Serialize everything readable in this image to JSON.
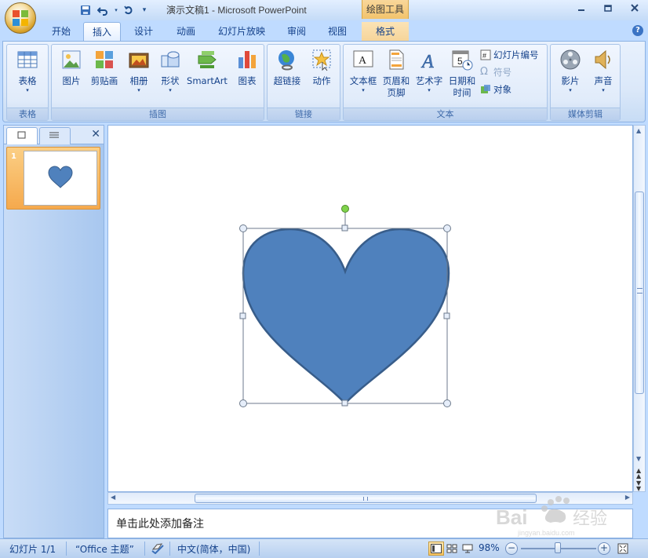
{
  "window": {
    "title": "演示文稿1 - Microsoft PowerPoint",
    "tool_tab_title": "绘图工具"
  },
  "tabs": [
    {
      "label": "开始",
      "active": false
    },
    {
      "label": "插入",
      "active": true
    },
    {
      "label": "设计",
      "active": false
    },
    {
      "label": "动画",
      "active": false
    },
    {
      "label": "幻灯片放映",
      "active": false
    },
    {
      "label": "审阅",
      "active": false
    },
    {
      "label": "视图",
      "active": false
    },
    {
      "label": "格式",
      "active": false
    }
  ],
  "ribbon": {
    "groups": {
      "table": "表格",
      "illustrations": "插图",
      "links": "链接",
      "text": "文本",
      "media": "媒体剪辑"
    },
    "buttons": {
      "table": "表格",
      "picture": "图片",
      "clipart": "剪贴画",
      "album": "相册",
      "shapes": "形状",
      "smartart": "SmartArt",
      "chart": "图表",
      "hyperlink": "超链接",
      "action": "动作",
      "textbox": "文本框",
      "header_footer_1": "页眉和",
      "header_footer_2": "页脚",
      "wordart": "艺术字",
      "datetime_1": "日期和",
      "datetime_2": "时间",
      "slide_number": "幻灯片编号",
      "symbol": "符号",
      "object": "对象",
      "movie": "影片",
      "sound": "声音"
    }
  },
  "slides_panel": {
    "thumbnail_number": "1"
  },
  "notes": {
    "placeholder": "单击此处添加备注"
  },
  "statusbar": {
    "slide_info": "幻灯片 1/1",
    "theme": "“Office 主题”",
    "language": "中文(简体，中国)",
    "zoom": "98%",
    "zoom_fraction": 0.49
  },
  "colors": {
    "heart_fill": "#4f81bd",
    "heart_stroke": "#385d8a",
    "rotation_handle": "#7fd34b"
  }
}
